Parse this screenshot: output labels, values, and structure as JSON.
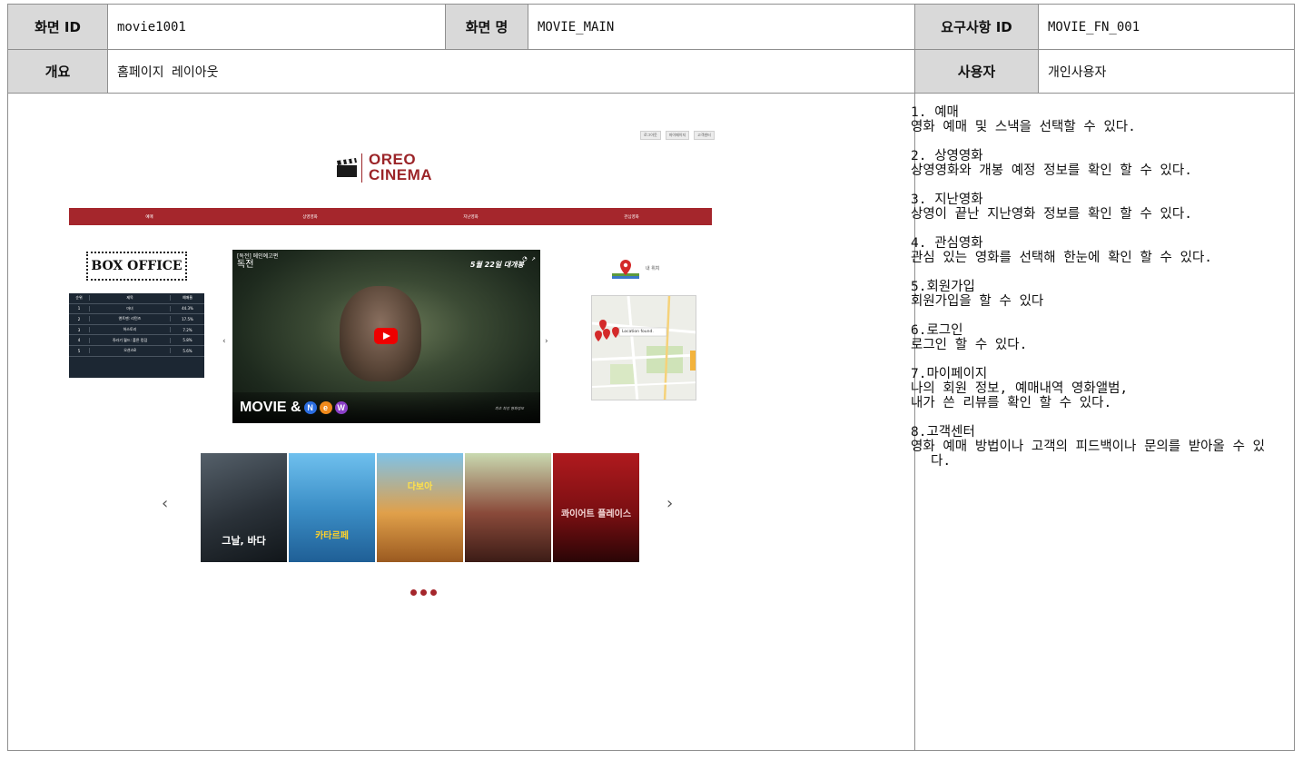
{
  "header": {
    "screen_id_label": "화면 ID",
    "screen_id_value": "movie1001",
    "screen_name_label": "화면 명",
    "screen_name_value": "MOVIE_MAIN",
    "req_id_label": "요구사항 ID",
    "req_id_value": "MOVIE_FN_001",
    "overview_label": "개요",
    "overview_value": "홈페이지 레이아웃",
    "user_label": "사용자",
    "user_value": "개인사용자"
  },
  "mockup": {
    "utility_links": [
      "로그아웃",
      "마이페이지",
      "고객센터"
    ],
    "logo_line1": "OREO",
    "logo_line2": "CINEMA",
    "nav": [
      "예매",
      "상영영화",
      "지난영화",
      "관심영화"
    ],
    "box_office_title": "BOX OFFICE",
    "box_office_header": {
      "rank": "순위",
      "title": "제목",
      "rate": "예매율"
    },
    "box_office_rows": [
      {
        "rank": "1",
        "title": "마녀",
        "rate": "44.3%"
      },
      {
        "rank": "2",
        "title": "앤트맨: 리턴즈",
        "rate": "17.5%"
      },
      {
        "rank": "3",
        "title": "허스토리",
        "rate": "7.2%"
      },
      {
        "rank": "4",
        "title": "쥬라기 월드: 폴른 킹덤",
        "rate": "5.8%"
      },
      {
        "rank": "5",
        "title": "오션스8",
        "rate": "5.6%"
      }
    ],
    "video_title_line1": "[독전] 메인예고편",
    "video_title_line2": "독전",
    "video_date": "5월 22일 대개봉",
    "video_brand": "MOVIE &",
    "video_brand_letters": [
      "N",
      "e",
      "W"
    ],
    "video_note": "최초 최강 영화정보",
    "location_label": "내 위치",
    "map_label": "Location found.",
    "posters": [
      {
        "title": "그날, 바다",
        "bg": "#2a3138"
      },
      {
        "title": "카타르페",
        "bg": "#3c8fc7"
      },
      {
        "title": "다보아",
        "bg": "#c07a2c"
      },
      {
        "title": "",
        "bg": "#8a4a3a"
      },
      {
        "title": "콰이어트 플레이스",
        "bg": "#7a0f12"
      }
    ],
    "arrow_left": "‹",
    "arrow_right": "›",
    "poster_arrow_left": "‹",
    "poster_arrow_right": "›"
  },
  "descriptions": [
    {
      "title": "1. 예매",
      "body": "영화 예매 및 스낵을 선택할 수 있다."
    },
    {
      "title": "2. 상영영화",
      "body": "상영영화와 개봉 예정 정보를 확인 할 수 있다."
    },
    {
      "title": "3. 지난영화",
      "body": "상영이 끝난 지난영화 정보를 확인 할 수 있다."
    },
    {
      "title": "4. 관심영화",
      "body": "관심 있는 영화를 선택해 한눈에  확인 할 수 있다."
    },
    {
      "title": "5.회원가입",
      "body": "회원가입을 할 수 있다"
    },
    {
      "title": "6.로그인",
      "body": "로그인 할 수 있다."
    },
    {
      "title": "7.마이페이지",
      "body": "나의 회원 정보, 예매내역 영화앨범,",
      "body2": "내가 쓴 리뷰를 확인 할 수 있다."
    },
    {
      "title": "8.고객센터",
      "body": "영화 예매 방법이나 고객의 피드백이나 문의를 받아올 수 있다."
    }
  ],
  "colors": {
    "accent": "#a5262c",
    "header_bg": "#d9d9d9",
    "table_bg": "#1c2733"
  }
}
